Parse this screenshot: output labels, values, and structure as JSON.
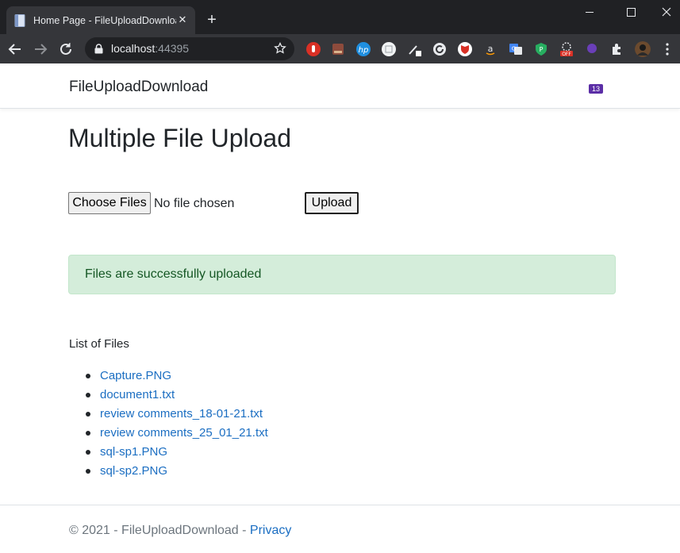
{
  "browser": {
    "tab_title": "Home Page - FileUploadDownload",
    "tab_close": "✕",
    "new_tab": "+",
    "url_host": "localhost",
    "url_port": ":44395",
    "extensions": [
      "red-hand-icon",
      "book-icon",
      "hp-icon",
      "white-box-icon",
      "pen-icon",
      "refresh-circle-icon",
      "shield-fox-icon",
      "amazon-icon",
      "translate-icon",
      "vpn-shield-icon",
      "off-badge-icon",
      "purple-cloud-icon",
      "puzzle-icon",
      "avatar"
    ],
    "extension_badge": "13"
  },
  "navbar": {
    "brand": "FileUploadDownload"
  },
  "main": {
    "title": "Multiple File Upload",
    "choose_files_label": "Choose Files",
    "file_status": "No file chosen",
    "upload_label": "Upload",
    "alert_text": "Files are successfully uploaded",
    "list_heading": "List of Files",
    "files": [
      "Capture.PNG",
      "document1.txt",
      "review comments_18-01-21.txt",
      "review comments_25_01_21.txt",
      "sql-sp1.PNG",
      "sql-sp2.PNG"
    ]
  },
  "footer": {
    "copyright": "© 2021 - FileUploadDownload - ",
    "privacy_label": "Privacy"
  },
  "colors": {
    "link": "#1b6ec2",
    "alert_bg": "#d4edda",
    "alert_text": "#155724",
    "chrome_dark": "#202124",
    "chrome_toolbar": "#35363a"
  }
}
